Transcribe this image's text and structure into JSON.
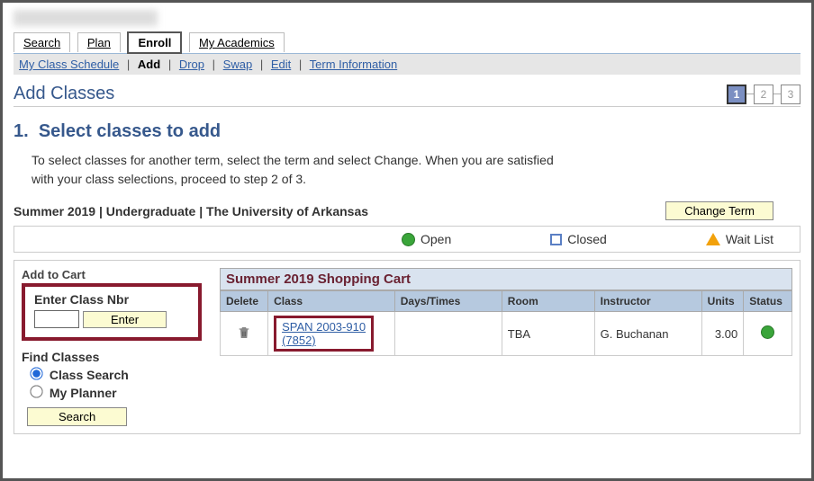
{
  "top_tabs": {
    "search": "Search",
    "plan": "Plan",
    "enroll": "Enroll",
    "my_academics": "My Academics"
  },
  "subnav": {
    "my_class_schedule": "My Class Schedule",
    "add": "Add",
    "drop": "Drop",
    "swap": "Swap",
    "edit": "Edit",
    "term_info": "Term Information"
  },
  "page_title": "Add Classes",
  "steps": {
    "s1": "1",
    "s2": "2",
    "s3": "3"
  },
  "heading_number": "1.",
  "heading_text": "Select classes to add",
  "intro_line1": "To select classes for another term, select the term and select Change.  When you are satisfied",
  "intro_line2": "with your class selections, proceed to step 2 of 3.",
  "term_line": "Summer 2019 | Undergraduate | The University of Arkansas",
  "change_term_btn": "Change Term",
  "legend": {
    "open": "Open",
    "closed": "Closed",
    "waitlist": "Wait List"
  },
  "left": {
    "add_to_cart": "Add to Cart",
    "enter_class_nbr": "Enter Class Nbr",
    "class_nbr_value": "",
    "enter_btn": "Enter",
    "find_classes": "Find Classes",
    "class_search": "Class Search",
    "my_planner": "My Planner",
    "search_btn": "Search"
  },
  "cart": {
    "title": "Summer 2019 Shopping Cart",
    "headers": {
      "delete": "Delete",
      "class": "Class",
      "days_times": "Days/Times",
      "room": "Room",
      "instructor": "Instructor",
      "units": "Units",
      "status": "Status"
    },
    "row": {
      "class_line1": "SPAN 2003-910",
      "class_line2": "(7852)",
      "days_times": "",
      "room": "TBA",
      "instructor": "G. Buchanan",
      "units": "3.00",
      "status_icon": "open"
    }
  }
}
